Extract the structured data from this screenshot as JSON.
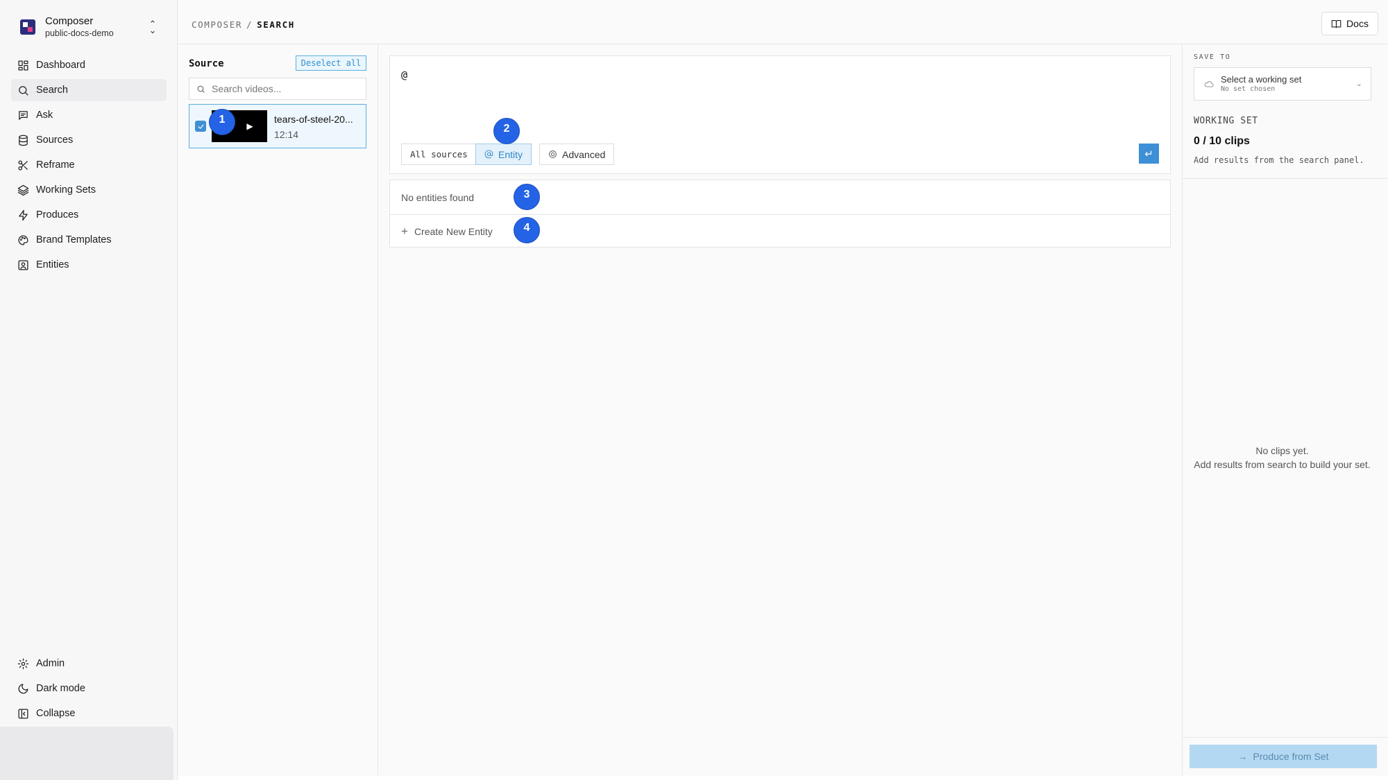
{
  "workspace": {
    "name": "Composer",
    "project": "public-docs-demo"
  },
  "nav": {
    "items": [
      {
        "label": "Dashboard",
        "icon": "dashboard-icon"
      },
      {
        "label": "Search",
        "icon": "search-icon"
      },
      {
        "label": "Ask",
        "icon": "chat-icon"
      },
      {
        "label": "Sources",
        "icon": "database-icon"
      },
      {
        "label": "Reframe",
        "icon": "scissors-icon"
      },
      {
        "label": "Working Sets",
        "icon": "layers-icon"
      },
      {
        "label": "Produces",
        "icon": "bolt-icon"
      },
      {
        "label": "Brand Templates",
        "icon": "palette-icon"
      },
      {
        "label": "Entities",
        "icon": "contact-icon"
      }
    ],
    "active": "Search",
    "bottom": [
      {
        "label": "Admin",
        "icon": "gear-icon"
      },
      {
        "label": "Dark mode",
        "icon": "moon-icon"
      },
      {
        "label": "Collapse",
        "icon": "collapse-icon"
      }
    ]
  },
  "header": {
    "breadcrumb_root": "COMPOSER",
    "breadcrumb_sep": "/",
    "breadcrumb_current": "SEARCH",
    "docs_label": "Docs"
  },
  "source": {
    "title": "Source",
    "deselect_label": "Deselect all",
    "search_placeholder": "Search videos...",
    "videos": [
      {
        "title": "tears-of-steel-20...",
        "duration": "12:14",
        "selected": true
      }
    ]
  },
  "query": {
    "text": "@",
    "filters": {
      "all_sources": "All sources",
      "entity": "Entity",
      "advanced": "Advanced"
    },
    "active_filter": "Entity",
    "send_glyph": "↵"
  },
  "entities": {
    "empty_text": "No entities found",
    "create_label": "Create New Entity"
  },
  "annotations": [
    "1",
    "2",
    "3",
    "4"
  ],
  "right_panel": {
    "save_to_label": "SAVE TO",
    "select_title": "Select a working set",
    "select_subtitle": "No set chosen",
    "working_set_label": "WORKING SET",
    "clip_count": "0 / 10 clips",
    "hint": "Add results from the search panel.",
    "empty_line1": "No clips yet.",
    "empty_line2": "Add results from search to build your set.",
    "produce_label": "Produce from Set"
  },
  "colors": {
    "accent": "#3d8fd6",
    "badge": "#2463e6",
    "produce_disabled": "#b3d8f1"
  }
}
